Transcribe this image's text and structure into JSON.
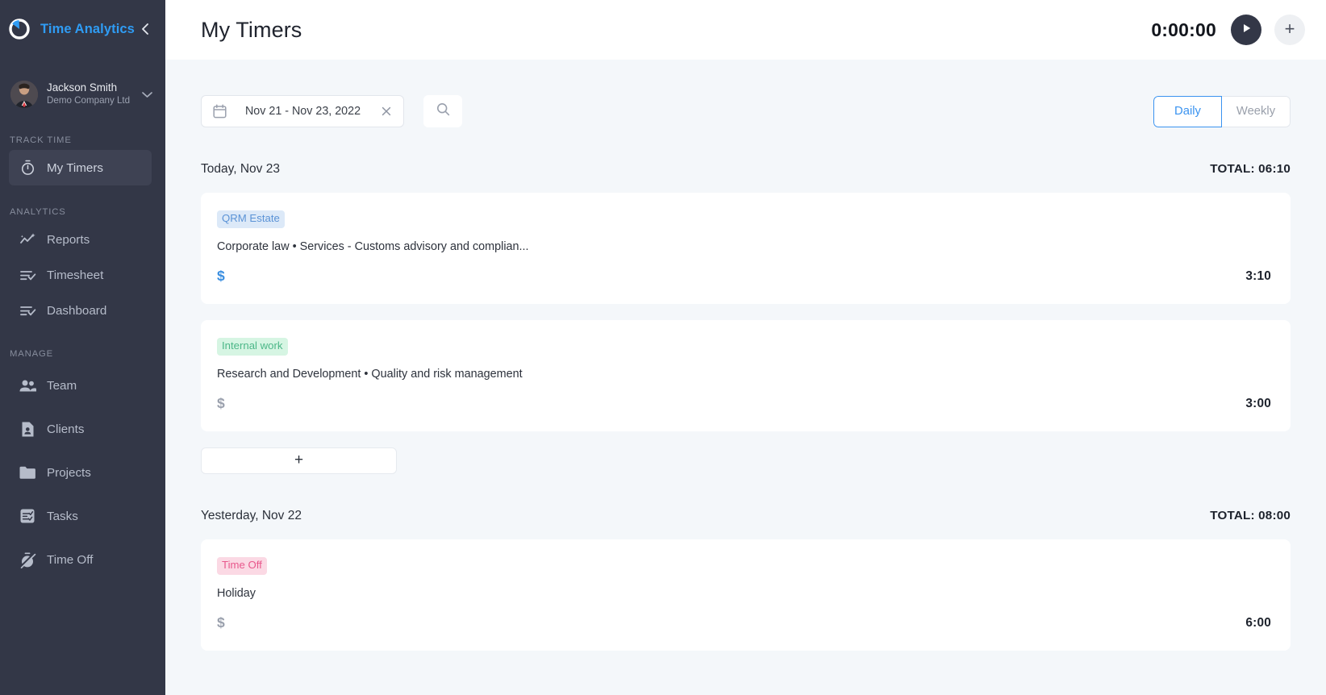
{
  "brand": {
    "name": "Time Analytics",
    "logo_icon": "circular-timer-logo",
    "collapse_icon": "chevron-left-icon"
  },
  "user": {
    "name": "Jackson Smith",
    "company": "Demo Company Ltd",
    "avatar_icon": "user-avatar",
    "caret_icon": "chevron-down-icon"
  },
  "sidebar": {
    "sections": [
      {
        "label": "TRACK TIME",
        "items": [
          {
            "label": "My Timers",
            "icon": "stopwatch-icon",
            "active": true
          }
        ]
      },
      {
        "label": "ANALYTICS",
        "items": [
          {
            "label": "Reports",
            "icon": "analytics-sparkline-icon",
            "active": false
          },
          {
            "label": "Timesheet",
            "icon": "list-check-icon",
            "active": false
          },
          {
            "label": "Dashboard",
            "icon": "list-check-icon",
            "active": false
          }
        ]
      },
      {
        "label": "MANAGE",
        "items": [
          {
            "label": "Team",
            "icon": "people-icon",
            "active": false
          },
          {
            "label": "Clients",
            "icon": "contact-card-icon",
            "active": false
          },
          {
            "label": "Projects",
            "icon": "folder-icon",
            "active": false
          },
          {
            "label": "Tasks",
            "icon": "task-list-icon",
            "active": false
          },
          {
            "label": "Time Off",
            "icon": "stopwatch-off-icon",
            "active": false
          }
        ]
      }
    ]
  },
  "header": {
    "title": "My Timers",
    "timer_value": "0:00:00",
    "play_icon": "play-icon",
    "add_icon": "plus-icon"
  },
  "filters": {
    "date_range": "Nov 21 - Nov 23, 2022",
    "calendar_icon": "calendar-icon",
    "clear_icon": "close-x-icon",
    "search_icon": "search-icon",
    "view_toggle": {
      "options": [
        {
          "label": "Daily",
          "selected": true
        },
        {
          "label": "Weekly",
          "selected": false
        }
      ]
    }
  },
  "days": [
    {
      "label": "Today, Nov 23",
      "total": "TOTAL: 06:10",
      "entries": [
        {
          "chip": "QRM Estate",
          "chip_color": "blue",
          "description": "Corporate law • Services - Customs advisory and complian...",
          "billable": true,
          "currency_symbol": "$",
          "duration": "3:10"
        },
        {
          "chip": "Internal work",
          "chip_color": "green",
          "description": "Research and Development • Quality and risk management",
          "billable": false,
          "currency_symbol": "$",
          "duration": "3:00"
        }
      ],
      "add_entry_label": "+"
    },
    {
      "label": "Yesterday, Nov 22",
      "total": "TOTAL: 08:00",
      "entries": [
        {
          "chip": "Time Off",
          "chip_color": "pink",
          "description": "Holiday",
          "billable": false,
          "currency_symbol": "$",
          "duration": "6:00"
        }
      ],
      "add_entry_label": null
    }
  ],
  "colors": {
    "sidebar_bg": "#333747",
    "brand_blue": "#2f9cf4",
    "accent_blue": "#3a93f0",
    "page_bg": "#f4f7fa",
    "chip_blue_bg": "#dce9f8",
    "chip_green_bg": "#d6f5e3",
    "chip_pink_bg": "#fbd9e4"
  }
}
